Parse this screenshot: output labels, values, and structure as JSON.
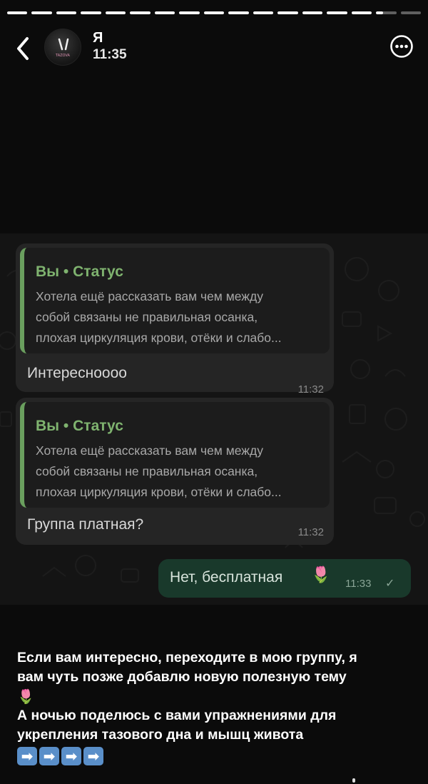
{
  "progress": [
    1,
    1,
    1,
    1,
    1,
    1,
    1,
    1,
    1,
    1,
    1,
    1,
    1,
    1,
    1,
    0.35,
    0
  ],
  "header": {
    "avatar_mark": "TAZOVA",
    "name": "Я",
    "time": "11:35"
  },
  "chat": {
    "messages": [
      {
        "quote_title": "Вы • Статус",
        "quote_text": "Хотела ещё рассказать вам  чем между\nсобой связаны не правильная  осанка,\nплохая циркуляция крови, отёки и слабо...",
        "text": "Интересноооо",
        "time": "11:32"
      },
      {
        "quote_title": "Вы • Статус",
        "quote_text": "Хотела ещё рассказать вам  чем между\nсобой связаны не правильная  осанка,\nплохая циркуляция крови, отёки и слабо...",
        "text": "Группа платная?",
        "time": "11:32"
      }
    ],
    "outgoing": {
      "text": "Нет, бесплатная",
      "emoji": "🌷",
      "time": "11:33",
      "check": "✓"
    }
  },
  "caption": {
    "line1": "Если вам интересно, переходите в мою группу, я",
    "line2": "вам чуть позже добавлю новую полезную тему",
    "emoji": "🌷",
    "line3": "А ночью поделюсь с вами упражнениями для",
    "line4": "укрепления тазового дна и мышц живота",
    "arrows": [
      "➡",
      "➡",
      "➡",
      "➡"
    ]
  },
  "colors": {
    "accent_green": "#7fb36f",
    "outgoing_bubble": "#19392b",
    "incoming_bubble": "#252525"
  },
  "icons": {
    "back": "chevron-left-icon",
    "more": "more-circle-icon"
  }
}
